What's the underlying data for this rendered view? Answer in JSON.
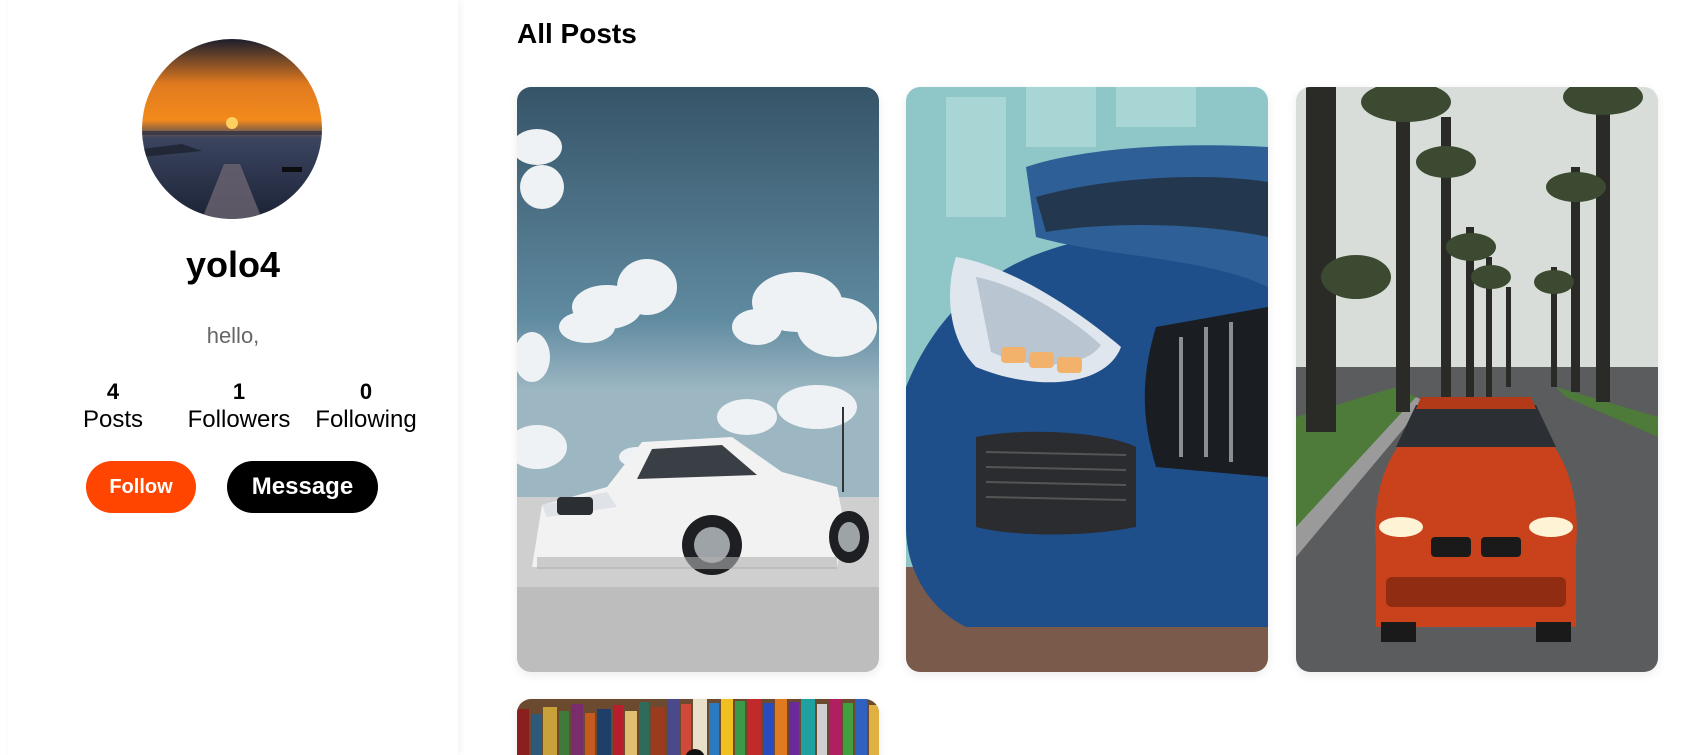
{
  "profile": {
    "username": "yolo4",
    "bio": "hello,",
    "avatar_icon": "sunset-avatar",
    "stats": [
      {
        "value": "4",
        "label": "Posts"
      },
      {
        "value": "1",
        "label": "Followers"
      },
      {
        "value": "0",
        "label": "Following"
      }
    ],
    "follow_label": "Follow",
    "message_label": "Message"
  },
  "posts": {
    "title": "All Posts",
    "items": [
      {
        "image": "white-coupe-clouds"
      },
      {
        "image": "blue-sports-car-headlight"
      },
      {
        "image": "orange-car-palm-street"
      },
      {
        "image": "bookshelf"
      }
    ]
  },
  "colors": {
    "follow_button": "#ff4500",
    "message_button": "#000000",
    "bio_text": "#666666"
  }
}
